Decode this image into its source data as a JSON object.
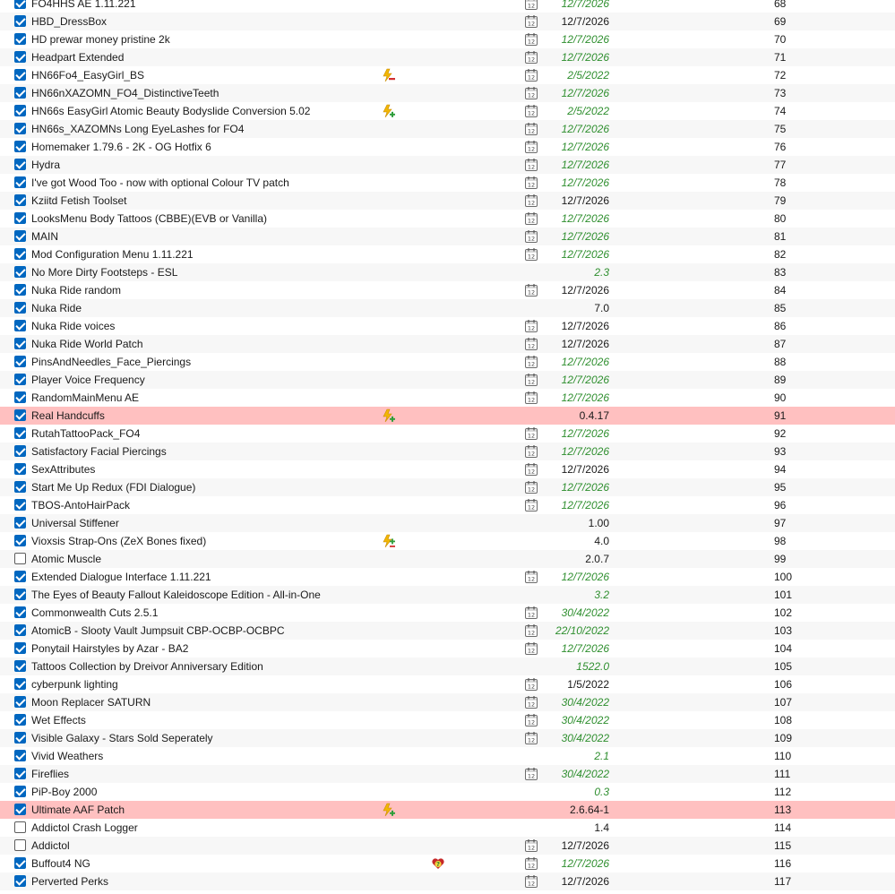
{
  "mods": [
    {
      "name": "FO4HHS AE 1.11.221",
      "checked": true,
      "flag": null,
      "calendar": true,
      "version": "12/7/2026",
      "version_style": "italic",
      "priority": "68",
      "highlight": false
    },
    {
      "name": "HBD_DressBox",
      "checked": true,
      "flag": null,
      "calendar": true,
      "version": "12/7/2026",
      "version_style": "plain",
      "priority": "69",
      "highlight": false
    },
    {
      "name": "HD prewar money pristine 2k",
      "checked": true,
      "flag": null,
      "calendar": true,
      "version": "12/7/2026",
      "version_style": "italic",
      "priority": "70",
      "highlight": false
    },
    {
      "name": "Headpart Extended",
      "checked": true,
      "flag": null,
      "calendar": true,
      "version": "12/7/2026",
      "version_style": "italic",
      "priority": "71",
      "highlight": false
    },
    {
      "name": "HN66Fo4_EasyGirl_BS",
      "checked": true,
      "flag": "lightning-minus-icon",
      "calendar": true,
      "version": "2/5/2022",
      "version_style": "italic",
      "priority": "72",
      "highlight": false
    },
    {
      "name": "HN66nXAZOMN_FO4_DistinctiveTeeth",
      "checked": true,
      "flag": null,
      "calendar": true,
      "version": "12/7/2026",
      "version_style": "italic",
      "priority": "73",
      "highlight": false
    },
    {
      "name": "HN66s EasyGirl Atomic Beauty Bodyslide Conversion 5.02",
      "checked": true,
      "flag": "lightning-plus-icon",
      "calendar": true,
      "version": "2/5/2022",
      "version_style": "italic",
      "priority": "74",
      "highlight": false
    },
    {
      "name": "HN66s_XAZOMNs Long EyeLashes for FO4",
      "checked": true,
      "flag": null,
      "calendar": true,
      "version": "12/7/2026",
      "version_style": "italic",
      "priority": "75",
      "highlight": false
    },
    {
      "name": "Homemaker 1.79.6 - 2K - OG Hotfix 6",
      "checked": true,
      "flag": null,
      "calendar": true,
      "version": "12/7/2026",
      "version_style": "italic",
      "priority": "76",
      "highlight": false
    },
    {
      "name": "Hydra",
      "checked": true,
      "flag": null,
      "calendar": true,
      "version": "12/7/2026",
      "version_style": "italic",
      "priority": "77",
      "highlight": false
    },
    {
      "name": "I've got Wood Too - now with optional Colour TV patch",
      "checked": true,
      "flag": null,
      "calendar": true,
      "version": "12/7/2026",
      "version_style": "italic",
      "priority": "78",
      "highlight": false
    },
    {
      "name": "Kziitd Fetish Toolset",
      "checked": true,
      "flag": null,
      "calendar": true,
      "version": "12/7/2026",
      "version_style": "plain",
      "priority": "79",
      "highlight": false
    },
    {
      "name": "LooksMenu Body Tattoos (CBBE)(EVB or Vanilla)",
      "checked": true,
      "flag": null,
      "calendar": true,
      "version": "12/7/2026",
      "version_style": "italic",
      "priority": "80",
      "highlight": false
    },
    {
      "name": "MAIN",
      "checked": true,
      "flag": null,
      "calendar": true,
      "version": "12/7/2026",
      "version_style": "italic",
      "priority": "81",
      "highlight": false
    },
    {
      "name": "Mod Configuration Menu 1.11.221",
      "checked": true,
      "flag": null,
      "calendar": true,
      "version": "12/7/2026",
      "version_style": "italic",
      "priority": "82",
      "highlight": false
    },
    {
      "name": "No More Dirty Footsteps - ESL",
      "checked": true,
      "flag": null,
      "calendar": false,
      "version": "2.3",
      "version_style": "italic",
      "priority": "83",
      "highlight": false
    },
    {
      "name": "Nuka Ride random",
      "checked": true,
      "flag": null,
      "calendar": true,
      "version": "12/7/2026",
      "version_style": "plain",
      "priority": "84",
      "highlight": false
    },
    {
      "name": "Nuka Ride",
      "checked": true,
      "flag": null,
      "calendar": false,
      "version": "7.0",
      "version_style": "plain",
      "priority": "85",
      "highlight": false
    },
    {
      "name": "Nuka Ride voices",
      "checked": true,
      "flag": null,
      "calendar": true,
      "version": "12/7/2026",
      "version_style": "plain",
      "priority": "86",
      "highlight": false
    },
    {
      "name": "Nuka Ride World Patch",
      "checked": true,
      "flag": null,
      "calendar": true,
      "version": "12/7/2026",
      "version_style": "plain",
      "priority": "87",
      "highlight": false
    },
    {
      "name": "PinsAndNeedles_Face_Piercings",
      "checked": true,
      "flag": null,
      "calendar": true,
      "version": "12/7/2026",
      "version_style": "italic",
      "priority": "88",
      "highlight": false
    },
    {
      "name": "Player Voice Frequency",
      "checked": true,
      "flag": null,
      "calendar": true,
      "version": "12/7/2026",
      "version_style": "italic",
      "priority": "89",
      "highlight": false
    },
    {
      "name": "RandomMainMenu AE",
      "checked": true,
      "flag": null,
      "calendar": true,
      "version": "12/7/2026",
      "version_style": "italic",
      "priority": "90",
      "highlight": false
    },
    {
      "name": "Real Handcuffs",
      "checked": true,
      "flag": "lightning-plus-icon",
      "calendar": false,
      "version": "0.4.17",
      "version_style": "plain",
      "priority": "91",
      "highlight": true
    },
    {
      "name": "RutahTattooPack_FO4",
      "checked": true,
      "flag": null,
      "calendar": true,
      "version": "12/7/2026",
      "version_style": "italic",
      "priority": "92",
      "highlight": false
    },
    {
      "name": "Satisfactory Facial Piercings",
      "checked": true,
      "flag": null,
      "calendar": true,
      "version": "12/7/2026",
      "version_style": "italic",
      "priority": "93",
      "highlight": false
    },
    {
      "name": "SexAttributes",
      "checked": true,
      "flag": null,
      "calendar": true,
      "version": "12/7/2026",
      "version_style": "plain",
      "priority": "94",
      "highlight": false
    },
    {
      "name": "Start Me Up Redux (FDI Dialogue)",
      "checked": true,
      "flag": null,
      "calendar": true,
      "version": "12/7/2026",
      "version_style": "italic",
      "priority": "95",
      "highlight": false
    },
    {
      "name": "TBOS-AntoHairPack",
      "checked": true,
      "flag": null,
      "calendar": true,
      "version": "12/7/2026",
      "version_style": "italic",
      "priority": "96",
      "highlight": false
    },
    {
      "name": "Universal Stiffener",
      "checked": true,
      "flag": null,
      "calendar": false,
      "version": "1.00",
      "version_style": "plain",
      "priority": "97",
      "highlight": false
    },
    {
      "name": "Vioxsis Strap-Ons (ZeX Bones fixed)",
      "checked": true,
      "flag": "lightning-plus-minus-icon",
      "calendar": false,
      "version": "4.0",
      "version_style": "plain",
      "priority": "98",
      "highlight": false
    },
    {
      "name": "Atomic Muscle",
      "checked": false,
      "flag": null,
      "calendar": false,
      "version": "2.0.7",
      "version_style": "plain",
      "priority": "99",
      "highlight": false
    },
    {
      "name": "Extended Dialogue Interface 1.11.221",
      "checked": true,
      "flag": null,
      "calendar": true,
      "version": "12/7/2026",
      "version_style": "italic",
      "priority": "100",
      "highlight": false
    },
    {
      "name": "The Eyes of Beauty Fallout Kaleidoscope Edition - All-in-One",
      "checked": true,
      "flag": null,
      "calendar": false,
      "version": "3.2",
      "version_style": "italic",
      "priority": "101",
      "highlight": false
    },
    {
      "name": "Commonwealth Cuts 2.5.1",
      "checked": true,
      "flag": null,
      "calendar": true,
      "version": "30/4/2022",
      "version_style": "italic",
      "priority": "102",
      "highlight": false
    },
    {
      "name": "AtomicB - Slooty Vault Jumpsuit CBP-OCBP-OCBPC",
      "checked": true,
      "flag": null,
      "calendar": true,
      "version": "22/10/2022",
      "version_style": "italic",
      "priority": "103",
      "highlight": false
    },
    {
      "name": "Ponytail Hairstyles by Azar - BA2",
      "checked": true,
      "flag": null,
      "calendar": true,
      "version": "12/7/2026",
      "version_style": "italic",
      "priority": "104",
      "highlight": false
    },
    {
      "name": "Tattoos Collection by Dreivor Anniversary Edition",
      "checked": true,
      "flag": null,
      "calendar": false,
      "version": "1522.0",
      "version_style": "italic",
      "priority": "105",
      "highlight": false
    },
    {
      "name": "cyberpunk lighting",
      "checked": true,
      "flag": null,
      "calendar": true,
      "version": "1/5/2022",
      "version_style": "plain",
      "priority": "106",
      "highlight": false
    },
    {
      "name": "Moon Replacer SATURN",
      "checked": true,
      "flag": null,
      "calendar": true,
      "version": "30/4/2022",
      "version_style": "italic",
      "priority": "107",
      "highlight": false
    },
    {
      "name": "Wet Effects",
      "checked": true,
      "flag": null,
      "calendar": true,
      "version": "30/4/2022",
      "version_style": "italic",
      "priority": "108",
      "highlight": false
    },
    {
      "name": "Visible Galaxy - Stars Sold Seperately",
      "checked": true,
      "flag": null,
      "calendar": true,
      "version": "30/4/2022",
      "version_style": "italic",
      "priority": "109",
      "highlight": false
    },
    {
      "name": "Vivid Weathers",
      "checked": true,
      "flag": null,
      "calendar": false,
      "version": "2.1",
      "version_style": "italic",
      "priority": "110",
      "highlight": false
    },
    {
      "name": "Fireflies",
      "checked": true,
      "flag": null,
      "calendar": true,
      "version": "30/4/2022",
      "version_style": "italic",
      "priority": "111",
      "highlight": false
    },
    {
      "name": "PiP-Boy 2000",
      "checked": true,
      "flag": null,
      "calendar": false,
      "version": "0.3",
      "version_style": "italic",
      "priority": "112",
      "highlight": false
    },
    {
      "name": "Ultimate AAF Patch",
      "checked": true,
      "flag": "lightning-plus-icon",
      "calendar": false,
      "version": "2.6.64-1",
      "version_style": "plain",
      "priority": "113",
      "highlight": true
    },
    {
      "name": "Addictol Crash Logger",
      "checked": false,
      "flag": null,
      "calendar": false,
      "version": "1.4",
      "version_style": "plain",
      "priority": "114",
      "highlight": false
    },
    {
      "name": "Addictol",
      "checked": false,
      "flag": null,
      "calendar": true,
      "version": "12/7/2026",
      "version_style": "plain",
      "priority": "115",
      "highlight": false
    },
    {
      "name": "Buffout4 NG",
      "checked": true,
      "flag": "heart-question-icon",
      "calendar": true,
      "version": "12/7/2026",
      "version_style": "italic",
      "priority": "116",
      "highlight": false
    },
    {
      "name": "Perverted Perks",
      "checked": true,
      "flag": null,
      "calendar": true,
      "version": "12/7/2026",
      "version_style": "plain",
      "priority": "117",
      "highlight": false
    }
  ],
  "colors": {
    "checkbox_blue": "#0067c0",
    "highlight_red": "#ffc0c0",
    "version_green": "#2f8f2f",
    "alt_row": "#f7f7f7"
  }
}
